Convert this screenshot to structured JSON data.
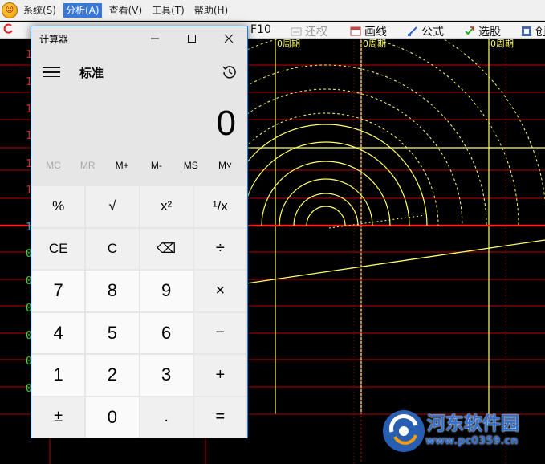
{
  "menubar": {
    "items": [
      "系统(S)",
      "分析(A)",
      "查看(V)",
      "工具(T)",
      "帮助(H)"
    ],
    "active_index": 1
  },
  "toolbar": {
    "items": [
      {
        "label": "F10",
        "icon": "document-icon"
      },
      {
        "label": "还权",
        "icon": "restore-icon",
        "disabled": true
      },
      {
        "label": "画线",
        "icon": "draw-line-icon"
      },
      {
        "label": "公式",
        "icon": "formula-icon"
      },
      {
        "label": "选股",
        "icon": "stock-pick-icon"
      },
      {
        "label": "创",
        "icon": "create-icon"
      }
    ]
  },
  "chart": {
    "cycle_labels": [
      "0周期",
      "0周期",
      "0周期"
    ],
    "left_labels": [
      {
        "text": "1",
        "color": "#ff3333"
      },
      {
        "text": "1",
        "color": "#ff3333"
      },
      {
        "text": "1",
        "color": "#ff3333"
      },
      {
        "text": "1",
        "color": "#ff3333"
      },
      {
        "text": "1",
        "color": "#ff3333"
      },
      {
        "text": "1",
        "color": "#ff3333"
      },
      {
        "text": "1",
        "color": "#33ccff"
      },
      {
        "text": "0",
        "color": "#33ff33"
      },
      {
        "text": "0",
        "color": "#33ff33"
      },
      {
        "text": "0",
        "color": "#33ff33"
      },
      {
        "text": "0",
        "color": "#33ff33"
      },
      {
        "text": "0",
        "color": "#33ff33"
      },
      {
        "text": "0",
        "color": "#33ff33"
      }
    ]
  },
  "calculator": {
    "window_title": "计算器",
    "mode": "标准",
    "display_value": "0",
    "memory": [
      {
        "label": "MC",
        "disabled": true
      },
      {
        "label": "MR",
        "disabled": true
      },
      {
        "label": "M+",
        "disabled": false
      },
      {
        "label": "M-",
        "disabled": false
      },
      {
        "label": "MS",
        "disabled": false
      },
      {
        "label": "M˅",
        "disabled": false
      }
    ],
    "keys": [
      {
        "label": "%",
        "kind": "fn",
        "name": "percent-key"
      },
      {
        "label": "√",
        "kind": "fn",
        "name": "sqrt-key"
      },
      {
        "label": "x²",
        "kind": "fn",
        "name": "square-key"
      },
      {
        "label": "¹/x",
        "kind": "fn",
        "name": "reciprocal-key"
      },
      {
        "label": "CE",
        "kind": "fn",
        "name": "clear-entry-key"
      },
      {
        "label": "C",
        "kind": "fn",
        "name": "clear-key"
      },
      {
        "label": "⌫",
        "kind": "fn",
        "name": "backspace-key"
      },
      {
        "label": "÷",
        "kind": "op",
        "name": "divide-key"
      },
      {
        "label": "7",
        "kind": "num",
        "name": "digit-7-key"
      },
      {
        "label": "8",
        "kind": "num",
        "name": "digit-8-key"
      },
      {
        "label": "9",
        "kind": "num",
        "name": "digit-9-key"
      },
      {
        "label": "×",
        "kind": "op",
        "name": "multiply-key"
      },
      {
        "label": "4",
        "kind": "num",
        "name": "digit-4-key"
      },
      {
        "label": "5",
        "kind": "num",
        "name": "digit-5-key"
      },
      {
        "label": "6",
        "kind": "num",
        "name": "digit-6-key"
      },
      {
        "label": "−",
        "kind": "op",
        "name": "subtract-key"
      },
      {
        "label": "1",
        "kind": "num",
        "name": "digit-1-key"
      },
      {
        "label": "2",
        "kind": "num",
        "name": "digit-2-key"
      },
      {
        "label": "3",
        "kind": "num",
        "name": "digit-3-key"
      },
      {
        "label": "+",
        "kind": "op",
        "name": "add-key"
      },
      {
        "label": "±",
        "kind": "op",
        "name": "negate-key"
      },
      {
        "label": "0",
        "kind": "num",
        "name": "digit-0-key"
      },
      {
        "label": ".",
        "kind": "op",
        "name": "decimal-key"
      },
      {
        "label": "=",
        "kind": "op",
        "name": "equals-key"
      }
    ]
  },
  "watermark": {
    "title": "河东软件园",
    "url": "www.pc0359.cn"
  }
}
